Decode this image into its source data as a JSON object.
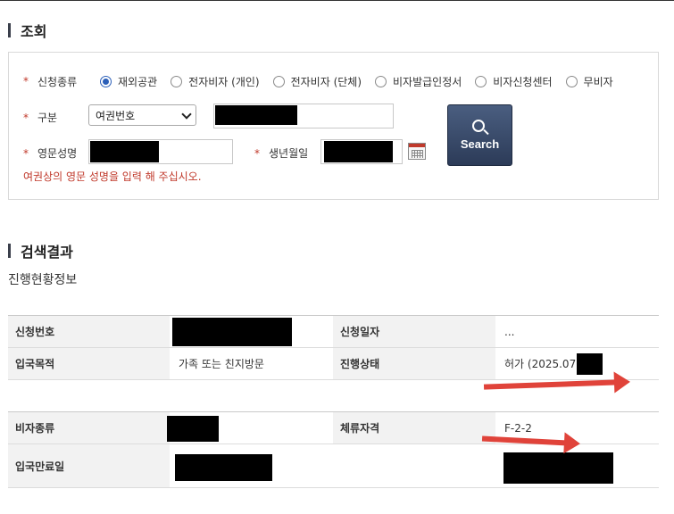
{
  "sections": {
    "inquiry_title": "조회",
    "result_title": "검색결과",
    "progress_title": "진행현황정보"
  },
  "form": {
    "apply_type_label": "신청종류",
    "radio_options": [
      "재외공관",
      "전자비자 (개인)",
      "전자비자 (단체)",
      "비자발급인정서",
      "비자신청센터",
      "무비자"
    ],
    "selected_option": "재외공관",
    "category_label": "구분",
    "category_value": "여권번호",
    "english_name_label": "영문성명",
    "birth_label": "생년월일",
    "hint": "여권상의 영문 성명을 입력 해 주십시오.",
    "search_button": "Search",
    "required_mark": "*"
  },
  "table1": {
    "rows": [
      {
        "h1": "신청번호",
        "v1": "",
        "h2": "신청일자",
        "v2": "..."
      },
      {
        "h1": "입국목적",
        "v1": "가족 또는 친지방문",
        "h2": "진행상태",
        "v2": "허가 (2025.07."
      }
    ]
  },
  "table2": {
    "rows": [
      {
        "h1": "비자종류",
        "v1": "",
        "h2": "체류자격",
        "v2": "F-2-2"
      },
      {
        "h1": "입국만료일",
        "v1": "",
        "h2": "",
        "v2": ""
      }
    ]
  },
  "colors": {
    "accent_red": "#e0433a",
    "button_navy": "#2c3b58",
    "radio_blue": "#2b5fb8"
  }
}
